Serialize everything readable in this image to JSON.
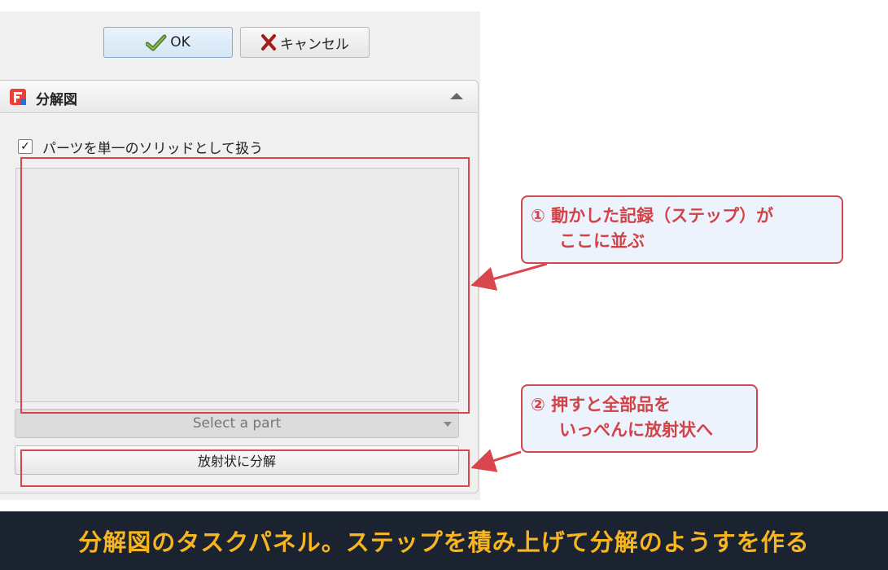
{
  "dialog": {
    "ok_label": "OK",
    "cancel_label": "キャンセル"
  },
  "section": {
    "title": "分解図",
    "checkbox_label": "パーツを単一のソリッドとして扱う",
    "checkbox_checked": true,
    "select_placeholder": "Select a part",
    "explode_button_label": "放射状に分解"
  },
  "callouts": {
    "c1_line1": "① 動かした記録（ステップ）が",
    "c1_line2": "ここに並ぶ",
    "c2_line1": "② 押すと全部品を",
    "c2_line2": "いっぺんに放射状へ"
  },
  "footer": {
    "caption": "分解図のタスクパネル。ステップを積み上げて分解のようすを作る"
  },
  "colors": {
    "annotation_red": "#d9474d",
    "footer_bg": "#1b2330",
    "footer_text": "#f6b521"
  }
}
